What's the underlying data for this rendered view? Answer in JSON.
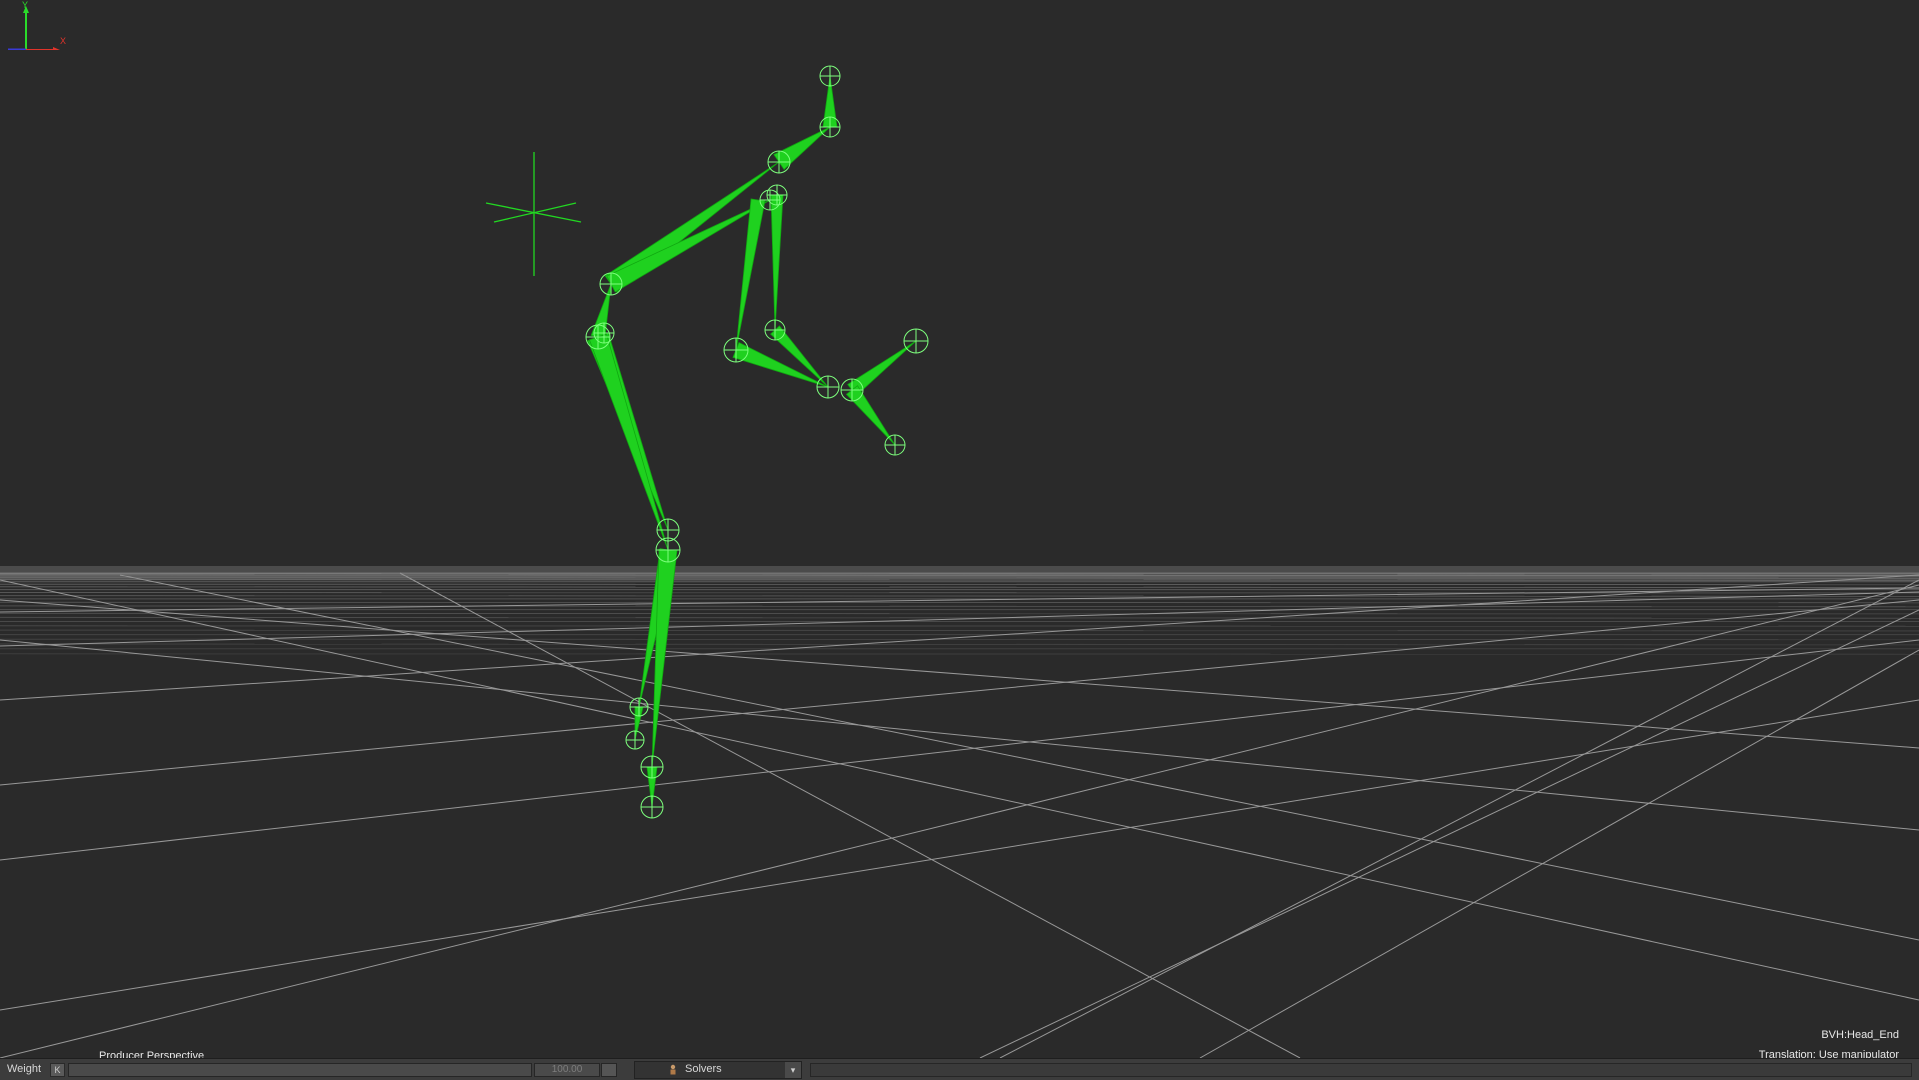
{
  "viewport": {
    "camera_label": "Producer Perspective",
    "selection_label": "BVH:Head_End",
    "manipulator_label": "Translation: Use manipulator",
    "background_color": "#2a2a2a",
    "grid_color": "#bfbfbf",
    "skeleton_color": "#1fd11f",
    "axis_labels": {
      "y": "Y",
      "x": "X"
    }
  },
  "bottom_bar": {
    "weight_label": "Weight",
    "weight_key": "K",
    "weight_value": "100.00",
    "solvers_label": "Solvers",
    "solvers_icon": "character-icon",
    "dropdown_icon": "chevron-down-icon"
  }
}
